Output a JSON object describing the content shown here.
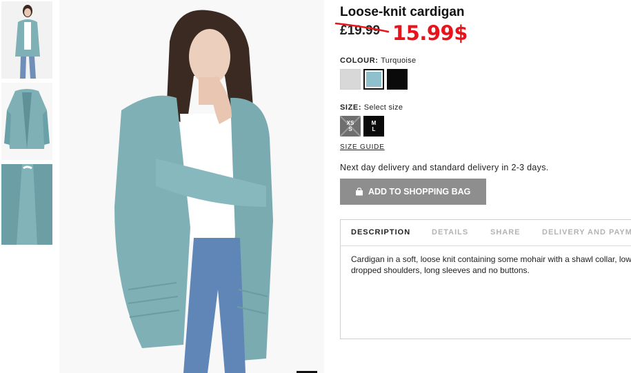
{
  "product": {
    "title": "Loose-knit cardigan",
    "old_price": "£19.99",
    "new_price": "15.99$"
  },
  "colour": {
    "label": "COLOUR:",
    "selected": "Turquoise",
    "swatches": [
      {
        "name": "grey",
        "color": "#d8d8d8"
      },
      {
        "name": "turquoise",
        "color": "#8fc1cc"
      },
      {
        "name": "black",
        "color": "#0a0a0a"
      }
    ]
  },
  "size": {
    "label": "SIZE:",
    "selected": "Select size",
    "options": [
      {
        "line1": "XS",
        "line2": "S",
        "available": false
      },
      {
        "line1": "M",
        "line2": "L",
        "available": true
      }
    ],
    "guide_label": "SIZE GUIDE"
  },
  "delivery_text": "Next day delivery and standard delivery in 2-3 days.",
  "add_to_bag_label": "ADD TO SHOPPING BAG",
  "tabs": [
    {
      "label": "DESCRIPTION",
      "active": true
    },
    {
      "label": "DETAILS",
      "active": false
    },
    {
      "label": "SHARE",
      "active": false
    },
    {
      "label": "DELIVERY AND PAYM",
      "active": false
    }
  ],
  "description": "Cardigan in a soft, loose knit containing some mohair with a shawl collar, low dropped shoulders, long sleeves and no buttons.",
  "colors": {
    "sale_price": "#e8141b",
    "button_bg": "#8e8e8e",
    "cardigan": "#7fb0b6"
  }
}
